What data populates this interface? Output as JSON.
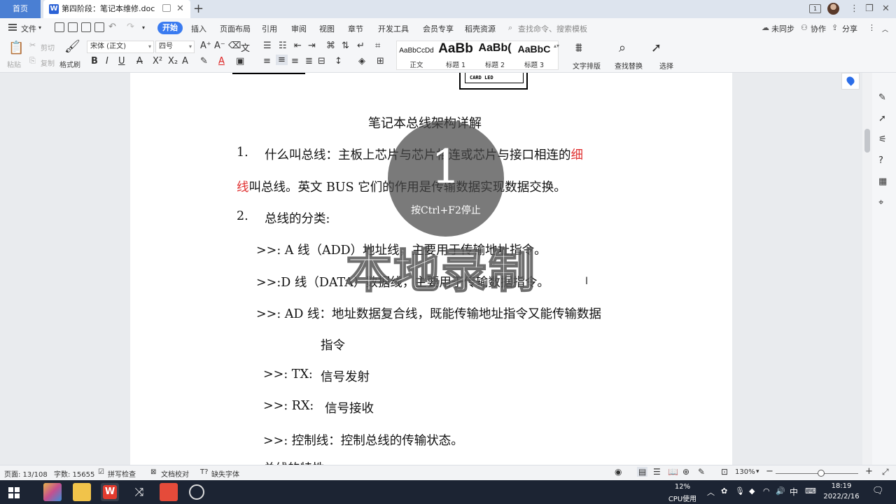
{
  "tabs": {
    "home": "首页",
    "doc_title": "第四阶段：笔记本维修.doc"
  },
  "menu": {
    "file": "文件",
    "items": [
      "开始",
      "插入",
      "页面布局",
      "引用",
      "审阅",
      "视图",
      "章节",
      "开发工具",
      "会员专享",
      "稻壳资源"
    ],
    "search_placeholder": "查找命令、搜索模板",
    "sync": "未同步",
    "collab": "协作",
    "share": "分享"
  },
  "ribbon": {
    "paste": "粘贴",
    "cut": "剪切",
    "copy": "复制",
    "format_painter": "格式刷",
    "font_name": "宋体 (正文)",
    "font_size": "四号",
    "styles": [
      {
        "preview": "AaBbCcDd",
        "name": "正文"
      },
      {
        "preview": "AaBb",
        "name": "标题 1"
      },
      {
        "preview": "AaBb(",
        "name": "标题 2"
      },
      {
        "preview": "AaBbC",
        "name": "标题 3"
      }
    ],
    "text_layout": "文字排版",
    "find_replace": "查找替换",
    "select": "选择"
  },
  "diagram": {
    "inner_label": "CARD LED"
  },
  "document": {
    "title": "笔记本总线架构详解",
    "p1_num": "1.",
    "p1_a": "什么叫总线：主板上芯片与芯片相连或芯片与接口相连的",
    "p1_red1": "细",
    "p1_red2": "线",
    "p1_b": "叫总线。英文 BUS 它们的作用是传输数据实现数据交换。",
    "p2_num": "2.",
    "p2": "总线的分类:",
    "l_add": ">>: A 线（ADD）地址线，主要用于传输地址指令。",
    "l_data": ">>:D 线（DATA）数据线，主要用于传输数据指令。",
    "l_ad": ">>: AD 线：地址数据复合线，既能传输地址指令又能传输数据",
    "l_ad2": "指令",
    "l_tx_k": ">>: TX:",
    "l_tx_v": "信号发射",
    "l_rx_k": ">>: RX:",
    "l_rx_v": "信号接收",
    "l_ctrl": ">>:  控制线：控制总线的传输状态。",
    "l_cut": "总线的特性"
  },
  "overlay": {
    "number": "1",
    "hint": "按Ctrl+F2停止",
    "watermark": "本地录制"
  },
  "status": {
    "page": "页面: 13/108",
    "words": "字数: 15655",
    "spell": "拼写检查",
    "proof": "文档校对",
    "missing_font": "缺失字体",
    "zoom": "130%"
  },
  "taskbar": {
    "cpu_pct": "12%",
    "cpu_label": "CPU使用",
    "ime": "中",
    "time": "18:19",
    "date": "2022/2/16"
  }
}
